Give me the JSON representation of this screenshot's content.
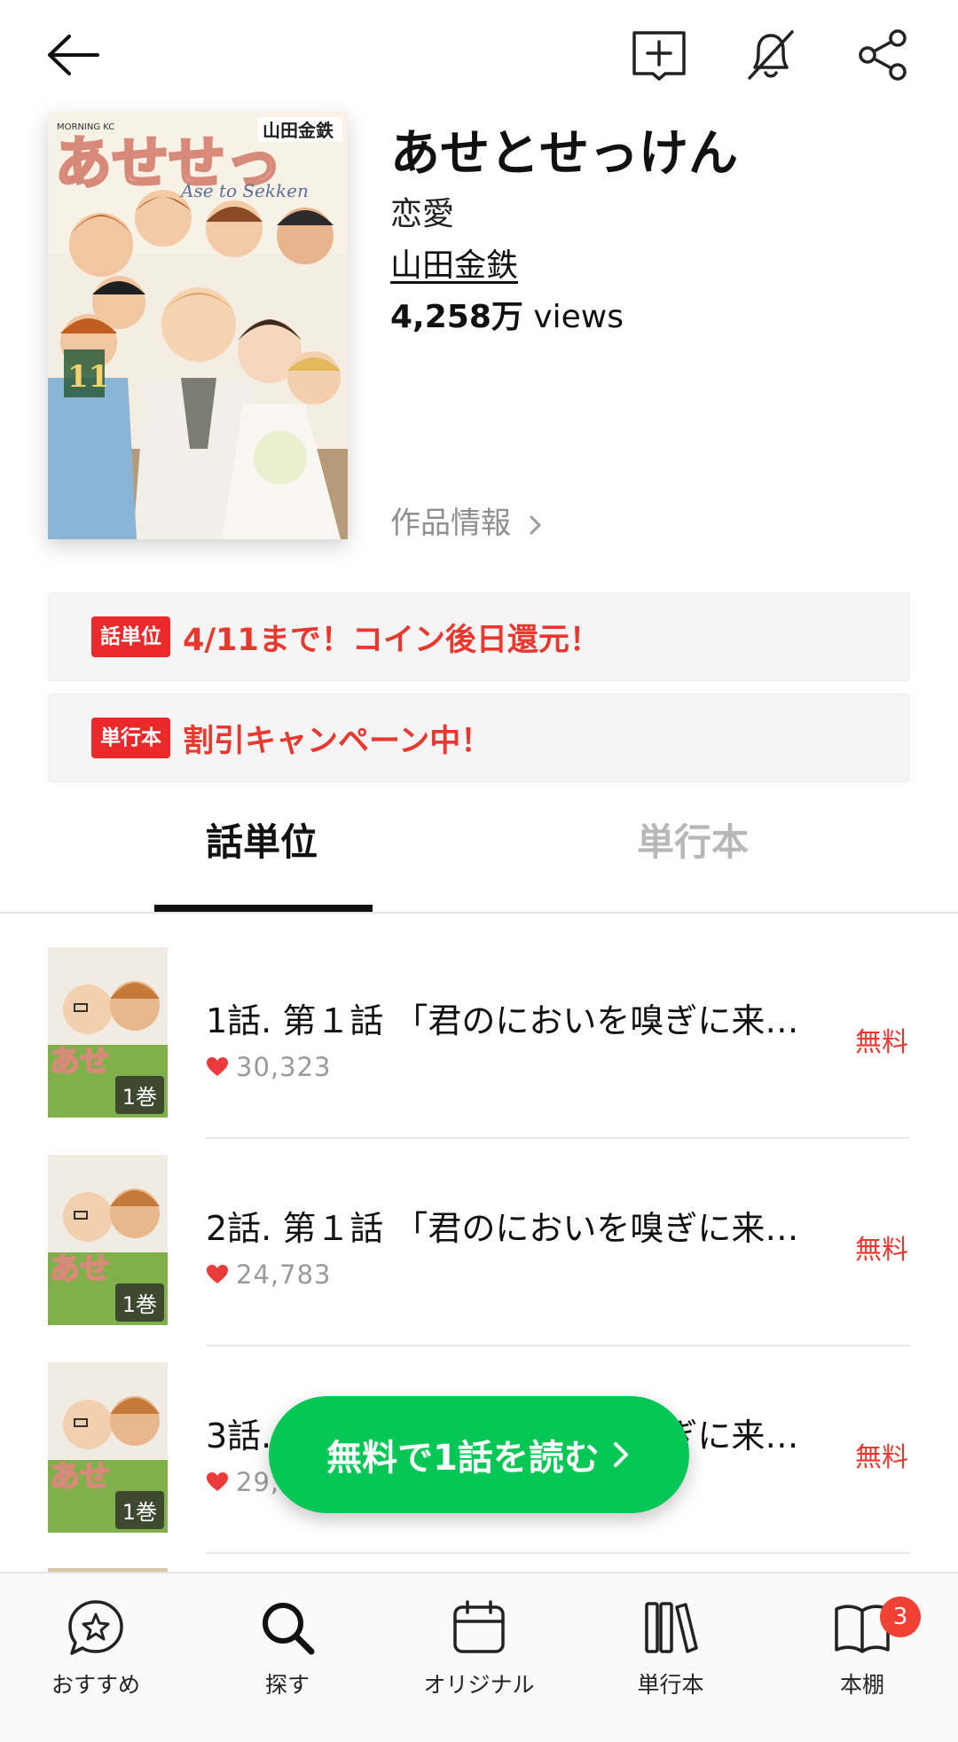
{
  "header": {
    "title": "あせとせっけん",
    "genre": "恋愛",
    "author": "山田金鉄",
    "views_number": "4,258万",
    "views_unit": "views",
    "info_link": "作品情報",
    "cover": {
      "label_top": "MORNING KC",
      "author_on_cover": "山田金鉄",
      "title_on_cover": "あせとせっけん",
      "subtitle_on_cover": "Ase to Sekken",
      "volume_on_cover": "11"
    }
  },
  "promos": [
    {
      "badge": "話単位",
      "text": "4/11まで！コイン後日還元！"
    },
    {
      "badge": "単行本",
      "text": "割引キャンペーン中！"
    }
  ],
  "tabs": [
    {
      "label": "話単位",
      "active": true
    },
    {
      "label": "単行本",
      "active": false
    }
  ],
  "episodes": [
    {
      "title": "1話. 第１話 「君のにおいを嗅ぎに来…",
      "likes": "30,323",
      "price": "無料",
      "volume": "1巻"
    },
    {
      "title": "2話. 第１話 「君のにおいを嗅ぎに来…",
      "likes": "24,783",
      "price": "無料",
      "volume": "1巻"
    },
    {
      "title": "3話. 第１話 「君のにおいを嗅ぎに来…",
      "likes": "29,",
      "price": "無料",
      "volume": "1巻"
    }
  ],
  "cta": {
    "label": "無料で1話を読む"
  },
  "bottom_nav": [
    {
      "label": "おすすめ",
      "icon": "star-bubble-icon"
    },
    {
      "label": "探す",
      "icon": "search-icon"
    },
    {
      "label": "オリジナル",
      "icon": "calendar-icon"
    },
    {
      "label": "単行本",
      "icon": "books-icon"
    },
    {
      "label": "本棚",
      "icon": "open-book-icon",
      "badge": "3"
    }
  ],
  "colors": {
    "accent_green": "#06c755",
    "promo_red": "#e8382f",
    "badge_red": "#ea2a2a"
  }
}
